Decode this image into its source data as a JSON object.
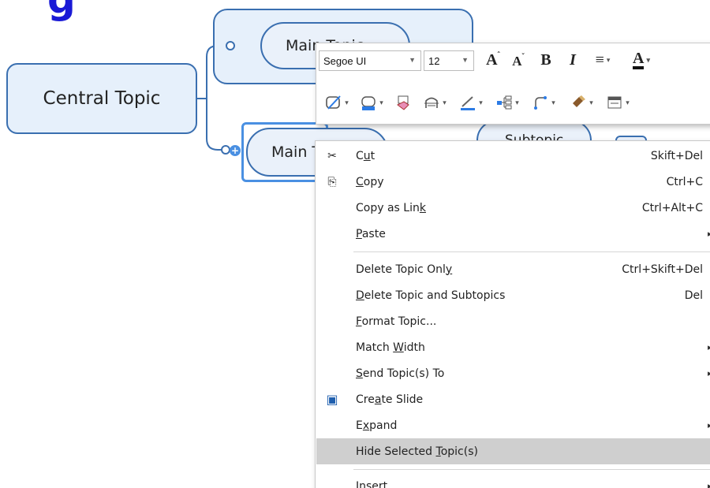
{
  "page": {
    "title_text": "g"
  },
  "mindmap": {
    "central_topic": "Central Topic",
    "main_topic_1": "Main Topic",
    "main_topic_2": "Main Topic",
    "subtopic": "Subtopic"
  },
  "mini_toolbar": {
    "font_name": "Segoe UI",
    "font_size": "12",
    "icons": {
      "grow_font": "grow-font-icon",
      "shrink_font": "shrink-font-icon",
      "bold": "bold-icon",
      "italic": "italic-icon",
      "align": "align-text-icon",
      "font_color": "font-color-icon",
      "topic_shape": "topic-shape-icon",
      "fill_color": "fill-color-icon",
      "clear_format": "clear-format-icon",
      "boundary": "boundary-icon",
      "line_color": "line-color-icon",
      "layout": "layout-icon",
      "connector": "connector-icon",
      "format_painter": "format-painter-icon",
      "more": "more-options-icon"
    },
    "glyphs": {
      "grow": "A",
      "shrink": "A",
      "bold": "B",
      "italic": "I",
      "align": "≡",
      "font_color": "A"
    }
  },
  "context_menu": {
    "items": [
      {
        "pre": "C",
        "u": "u",
        "post": "t",
        "shortcut": "Skift+Del",
        "icon": "scissors-icon",
        "glyph": "✂"
      },
      {
        "pre": "",
        "u": "C",
        "post": "opy",
        "shortcut": "Ctrl+C",
        "icon": "copy-icon",
        "glyph": "⎘"
      },
      {
        "pre": "Copy as Lin",
        "u": "k",
        "post": "",
        "shortcut": "Ctrl+Alt+C"
      },
      {
        "pre": "",
        "u": "P",
        "post": "aste",
        "submenu": "▸"
      },
      {
        "pre": "Delete Topic Onl",
        "u": "y",
        "post": "",
        "shortcut": "Ctrl+Skift+Del"
      },
      {
        "pre": "",
        "u": "D",
        "post": "elete Topic and Subtopics",
        "shortcut": "Del"
      },
      {
        "pre": "",
        "u": "F",
        "post": "ormat Topic...",
        "shortcut": ""
      },
      {
        "pre": "Match ",
        "u": "W",
        "post": "idth",
        "submenu": "▸"
      },
      {
        "pre": "",
        "u": "S",
        "post": "end Topic(s) To",
        "submenu": "▸"
      },
      {
        "pre": "Cre",
        "u": "a",
        "post": "te Slide",
        "icon": "slide-icon",
        "glyph": "▣"
      },
      {
        "pre": "E",
        "u": "x",
        "post": "pand",
        "submenu": "▸"
      },
      {
        "pre": "Hide Selected ",
        "u": "T",
        "post": "opic(s)",
        "highlighted": true
      },
      {
        "pre": "",
        "u": "I",
        "post": "nsert",
        "submenu": "▸"
      }
    ]
  },
  "colors": {
    "topic_border": "#3a6fb0",
    "topic_fill": "#eaf1fa",
    "selection": "#4a90e2",
    "title": "#1a1ad6",
    "menu_highlight": "#cfcfcf"
  }
}
